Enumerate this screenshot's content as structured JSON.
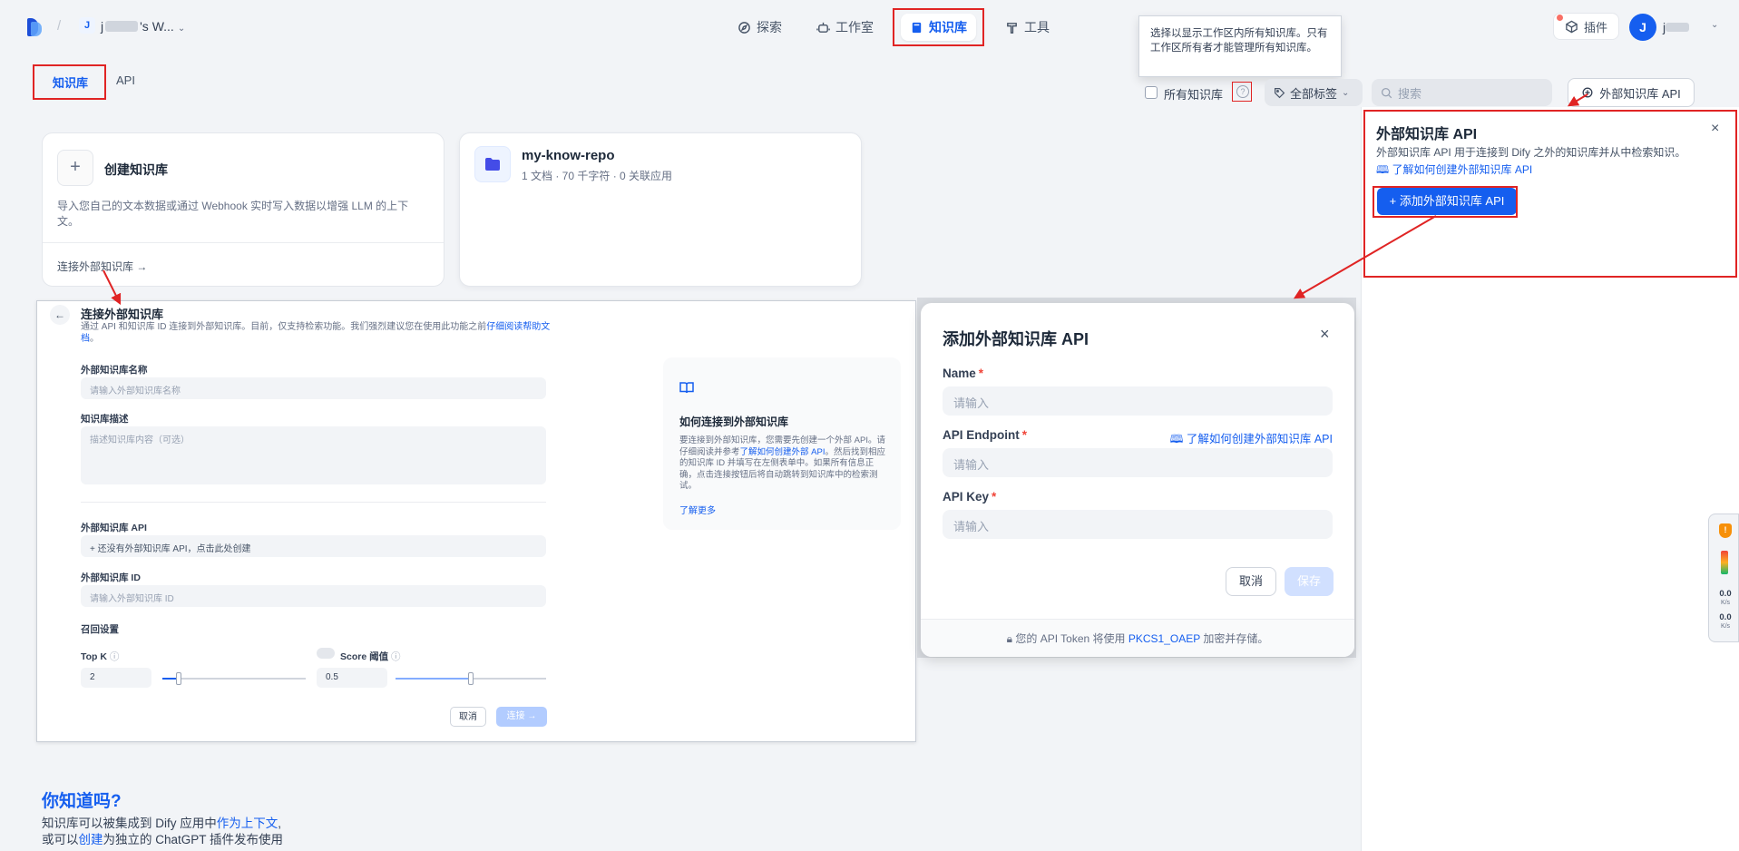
{
  "header": {
    "workspace_initial": "J",
    "workspace_name_prefix": "j",
    "workspace_name_suffix": "'s W...",
    "nav": [
      {
        "label": "探索",
        "icon": "compass-icon"
      },
      {
        "label": "工作室",
        "icon": "robot-icon"
      },
      {
        "label": "知识库",
        "icon": "book-icon",
        "active": true
      },
      {
        "label": "工具",
        "icon": "tool-icon"
      }
    ],
    "tooltip": "选择以显示工作区内所有知识库。只有工作区所有者才能管理所有知识库。",
    "plugin_label": "插件",
    "user_initial": "J",
    "user_name_prefix": "j"
  },
  "tabs": [
    {
      "label": "知识库",
      "active": true
    },
    {
      "label": "API",
      "active": false
    }
  ],
  "toolbar": {
    "all_kb_label": "所有知识库",
    "tags_label": "全部标签",
    "search_placeholder": "搜索",
    "external_api_label": "外部知识库 API"
  },
  "create_card": {
    "plus": "+",
    "title": "创建知识库",
    "description": "导入您自己的文本数据或通过 Webhook 实时写入数据以增强 LLM 的上下文。",
    "connect_link": "连接外部知识库 →"
  },
  "repo_card": {
    "title": "my-know-repo",
    "meta": "1 文档 · 70 千字符 · 0 关联应用"
  },
  "connect_panel": {
    "back": "←",
    "title": "连接外部知识库",
    "description": "通过 API 和知识库 ID 连接到外部知识库。目前，仅支持检索功能。我们强烈建议您在使用此功能之前",
    "description_link": "仔细阅读帮助文档",
    "description_end": "。",
    "name_label": "外部知识库名称",
    "name_placeholder": "请输入外部知识库名称",
    "desc_label": "知识库描述",
    "desc_placeholder": "描述知识库内容（可选）",
    "api_label": "外部知识库 API",
    "api_placeholder": "+ 还没有外部知识库 API，点击此处创建",
    "id_label": "外部知识库 ID",
    "id_placeholder": "请输入外部知识库 ID",
    "retrieval_label": "召回设置",
    "topk_label": "Top K",
    "topk_value": "2",
    "score_label": "Score 阈值",
    "score_value": "0.5",
    "cancel": "取消",
    "connect": "连接 →",
    "how_title": "如何连接到外部知识库",
    "how_desc_1": "要连接到外部知识库，您需要先创建一个外部 API。请仔细阅读并参考",
    "how_desc_link": "了解如何创建外部 API",
    "how_desc_2": "。然后找到相应的知识库 ID 并填写在左侧表单中。如果所有信息正确，点击连接按钮后将自动跳转到知识库中的检索测试。",
    "how_more": "了解更多"
  },
  "modal": {
    "title": "添加外部知识库 API",
    "close": "×",
    "name_label": "Name",
    "name_placeholder": "请输入",
    "endpoint_label": "API Endpoint",
    "endpoint_link": "了解如何创建外部知识库 API",
    "endpoint_placeholder": "请输入",
    "key_label": "API Key",
    "key_placeholder": "请输入",
    "cancel": "取消",
    "save": "保存",
    "footer_text": "您的 API Token 将使用",
    "footer_link": "PKCS1_OAEP",
    "footer_end": "加密并存储。"
  },
  "side_panel": {
    "title": "外部知识库 API",
    "close": "×",
    "description": "外部知识库 API 用于连接到 Dify 之外的知识库并从中检索知识。",
    "link": "了解如何创建外部知识库 API",
    "add_button": "+ 添加外部知识库 API"
  },
  "did_you_know": {
    "title": "你知道吗?",
    "line1_pre": "知识库可以被集成到 Dify 应用中",
    "line1_link": "作为上下文",
    "line1_end": ",",
    "line2_pre": "或可以",
    "line2_link": "创建",
    "line2_end": "为独立的 ChatGPT 插件发布使用"
  },
  "speed_widget": {
    "up_value": "0.0",
    "up_unit": "K/s",
    "down_value": "0.0",
    "down_unit": "K/s"
  },
  "colors": {
    "accent": "#155eef",
    "annotation_red": "#e02424"
  }
}
